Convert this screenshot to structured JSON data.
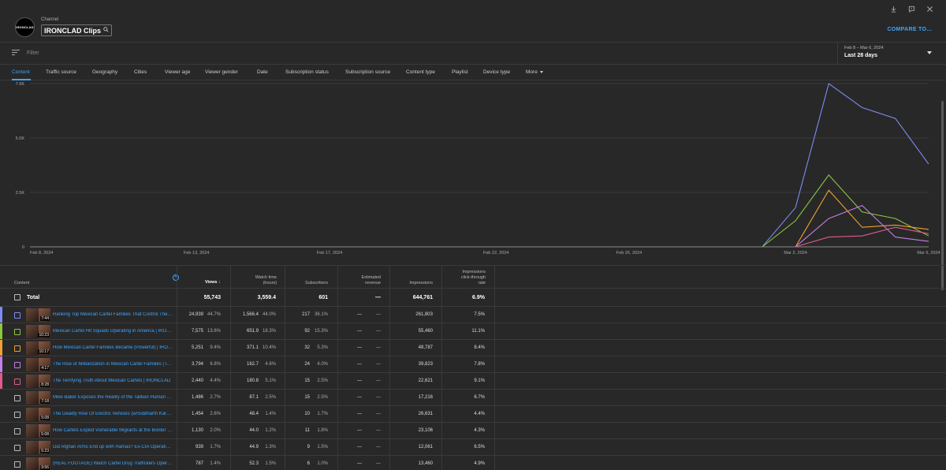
{
  "header": {
    "avatar_text": "IRONCLAD",
    "channel_label": "Channel",
    "channel_name": "IRONCLAD Clips",
    "compare_label": "COMPARE TO..."
  },
  "filter": {
    "placeholder": "Filter"
  },
  "date_range": {
    "range_text": "Feb 8 – Mar 6, 2024",
    "label": "Last 28 days"
  },
  "tabs": [
    {
      "label": "Content"
    },
    {
      "label": "Traffic source"
    },
    {
      "label": "Geography"
    },
    {
      "label": "Cities"
    },
    {
      "label": "Viewer age"
    },
    {
      "label": "Viewer gender"
    },
    {
      "label": "Date"
    },
    {
      "label": "Subscription status"
    },
    {
      "label": "Subscription source"
    },
    {
      "label": "Content type"
    },
    {
      "label": "Playlist"
    },
    {
      "label": "Device type"
    },
    {
      "label": "More"
    }
  ],
  "chart_data": {
    "type": "line",
    "ytick_labels": [
      "0",
      "2.5K",
      "5.0K",
      "7.5K"
    ],
    "xtick_labels": [
      "Feb 8, 2024",
      "Feb 13, 2024",
      "Feb 17, 2024",
      "Feb 22, 2024",
      "Feb 26, 2024",
      "Mar 2, 2024",
      "Mar 6, 2024"
    ],
    "ylim": [
      0,
      7500
    ],
    "grid": true,
    "x": [
      "Feb 8",
      "Feb 9",
      "Feb 10",
      "Feb 11",
      "Feb 12",
      "Feb 13",
      "Feb 14",
      "Feb 15",
      "Feb 16",
      "Feb 17",
      "Feb 18",
      "Feb 19",
      "Feb 20",
      "Feb 21",
      "Feb 22",
      "Feb 23",
      "Feb 24",
      "Feb 25",
      "Feb 26",
      "Feb 27",
      "Feb 28",
      "Feb 29",
      "Mar 1",
      "Mar 2",
      "Mar 3",
      "Mar 4",
      "Mar 5",
      "Mar 6"
    ],
    "series": [
      {
        "color": "#7b8cf2",
        "values": [
          0,
          0,
          0,
          0,
          0,
          0,
          0,
          0,
          0,
          0,
          0,
          0,
          0,
          0,
          0,
          0,
          0,
          0,
          0,
          0,
          0,
          0,
          0,
          1800,
          7500,
          6400,
          5900,
          3800
        ]
      },
      {
        "color": "#8dc63f",
        "values": [
          0,
          0,
          0,
          0,
          0,
          0,
          0,
          0,
          0,
          0,
          0,
          0,
          0,
          0,
          0,
          0,
          0,
          0,
          0,
          0,
          0,
          0,
          0,
          1200,
          3300,
          1600,
          1300,
          500
        ]
      },
      {
        "color": "#f0a030",
        "values": [
          0,
          0,
          0,
          0,
          0,
          0,
          0,
          0,
          0,
          0,
          0,
          0,
          0,
          0,
          0,
          0,
          0,
          0,
          0,
          0,
          0,
          0,
          0,
          0,
          2600,
          900,
          1000,
          800
        ]
      },
      {
        "color": "#c77ee8",
        "values": [
          0,
          0,
          0,
          0,
          0,
          0,
          0,
          0,
          0,
          0,
          0,
          0,
          0,
          0,
          0,
          0,
          0,
          0,
          0,
          0,
          0,
          0,
          0,
          0,
          1300,
          1900,
          450,
          250
        ]
      },
      {
        "color": "#e05a8a",
        "values": [
          0,
          0,
          0,
          0,
          0,
          0,
          0,
          0,
          0,
          0,
          0,
          0,
          0,
          0,
          0,
          0,
          0,
          0,
          0,
          0,
          0,
          0,
          0,
          0,
          450,
          500,
          900,
          600
        ]
      },
      {
        "color": "#888888",
        "values": [
          0,
          0,
          0,
          0,
          0,
          0,
          0,
          0,
          0,
          0,
          0,
          0,
          0,
          0,
          0,
          0,
          0,
          0,
          0,
          0,
          0,
          0,
          0,
          0,
          0,
          0,
          0,
          0
        ]
      }
    ]
  },
  "table": {
    "headers": {
      "content": "Content",
      "views": "Views",
      "watch_time_1": "Watch time",
      "watch_time_2": "(hours)",
      "subscribers": "Subscribers",
      "revenue_1": "Estimated",
      "revenue_2": "revenue",
      "impressions": "Impressions",
      "ctr_1": "Impressions",
      "ctr_2": "click-through",
      "ctr_3": "rate"
    },
    "total": {
      "label": "Total",
      "views": "55,743",
      "watch_time": "3,559.4",
      "subscribers": "601",
      "revenue": "—",
      "impressions": "644,761",
      "ctr": "6.9%"
    },
    "rows": [
      {
        "color": "#7b8cf2",
        "duration": "7:44",
        "title": "Ranking Top Mexican Cartel Families That Control The …",
        "views": "24,939",
        "views_pct": "44.7%",
        "watch": "1,566.4",
        "watch_pct": "44.0%",
        "subs": "217",
        "subs_pct": "36.1%",
        "rev": "—",
        "rev_pct": "—",
        "impr": "261,803",
        "ctr": "7.5%"
      },
      {
        "color": "#8dc63f",
        "duration": "10:23",
        "title": "Mexican Cartel Hit Squads Operating in America | IRO…",
        "views": "7,575",
        "views_pct": "13.6%",
        "watch": "651.9",
        "watch_pct": "18.3%",
        "subs": "92",
        "subs_pct": "15.3%",
        "rev": "—",
        "rev_pct": "—",
        "impr": "55,460",
        "ctr": "11.1%"
      },
      {
        "color": "#f0a030",
        "duration": "10:17",
        "title": "How Mexican Cartel Families Became (Powerful) | IRO…",
        "views": "5,251",
        "views_pct": "9.4%",
        "watch": "371.1",
        "watch_pct": "10.4%",
        "subs": "32",
        "subs_pct": "5.3%",
        "rev": "—",
        "rev_pct": "—",
        "impr": "48,787",
        "ctr": "8.4%"
      },
      {
        "color": "#c77ee8",
        "duration": "4:17",
        "title": "The Rise of Militarization in Mexican Cartel Families | I…",
        "views": "3,794",
        "views_pct": "6.8%",
        "watch": "162.7",
        "watch_pct": "4.6%",
        "subs": "24",
        "subs_pct": "4.0%",
        "rev": "—",
        "rev_pct": "—",
        "impr": "39,823",
        "ctr": "7.8%"
      },
      {
        "color": "#e05a8a",
        "duration": "8:28",
        "title": "The Terrifying Truth About Mexican Cartels | IRONCLAD",
        "views": "2,440",
        "views_pct": "4.4%",
        "watch": "180.8",
        "watch_pct": "5.1%",
        "subs": "15",
        "subs_pct": "2.5%",
        "rev": "—",
        "rev_pct": "—",
        "impr": "22,621",
        "ctr": "9.1%"
      },
      {
        "color": "",
        "duration": "7:18",
        "title": "Mike Baker Exposes the Reality of the Taliban Human …",
        "views": "1,486",
        "views_pct": "2.7%",
        "watch": "87.1",
        "watch_pct": "2.5%",
        "subs": "15",
        "subs_pct": "2.5%",
        "rev": "—",
        "rev_pct": "—",
        "impr": "17,216",
        "ctr": "6.7%"
      },
      {
        "color": "",
        "duration": "5:08",
        "title": "The Deadly Rise Of Electric Vehicles (w/Siddharth Kara…",
        "views": "1,454",
        "views_pct": "2.6%",
        "watch": "48.4",
        "watch_pct": "1.4%",
        "subs": "10",
        "subs_pct": "1.7%",
        "rev": "—",
        "rev_pct": "—",
        "impr": "26,631",
        "ctr": "4.4%"
      },
      {
        "color": "",
        "duration": "5:08",
        "title": "How Cartels Exploit Vulnerable Migrants at the Border I…",
        "views": "1,130",
        "views_pct": "2.0%",
        "watch": "44.0",
        "watch_pct": "1.2%",
        "subs": "11",
        "subs_pct": "1.8%",
        "rev": "—",
        "rev_pct": "—",
        "impr": "23,106",
        "ctr": "4.3%"
      },
      {
        "color": "",
        "duration": "5:23",
        "title": "Did Afghan Arms End up with Hamas? Ex-CIA Operativ…",
        "views": "939",
        "views_pct": "1.7%",
        "watch": "44.9",
        "watch_pct": "1.3%",
        "subs": "9",
        "subs_pct": "1.5%",
        "rev": "—",
        "rev_pct": "—",
        "impr": "12,061",
        "ctr": "6.5%"
      },
      {
        "color": "",
        "duration": "9:56",
        "title": "(REAL FOOTAGE) Watch Cartel Drug Traffickers Operat…",
        "views": "787",
        "views_pct": "1.4%",
        "watch": "52.3",
        "watch_pct": "1.5%",
        "subs": "6",
        "subs_pct": "1.0%",
        "rev": "—",
        "rev_pct": "—",
        "impr": "13,460",
        "ctr": "4.9%"
      }
    ]
  }
}
